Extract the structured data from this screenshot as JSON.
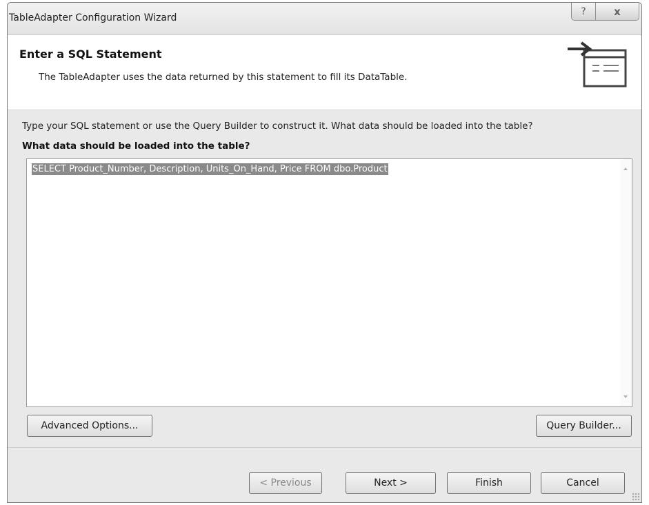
{
  "window": {
    "title": "TableAdapter Configuration Wizard",
    "help_glyph": "?",
    "close_glyph": "x"
  },
  "header": {
    "title": "Enter a SQL Statement",
    "description": "The TableAdapter uses the data returned by this statement to fill its DataTable.",
    "icon": "sql-statement-icon"
  },
  "body": {
    "instructions": "Type your SQL statement or use the Query Builder to construct it. What data should be loaded into the table?",
    "prompt": "What data should be loaded into the table?",
    "sql_text": "SELECT Product_Number, Description, Units_On_Hand, Price FROM dbo.Product"
  },
  "buttons": {
    "advanced_options": "Advanced Options...",
    "query_builder": "Query Builder...",
    "previous": "< Previous",
    "next": "Next >",
    "finish": "Finish",
    "cancel": "Cancel"
  }
}
